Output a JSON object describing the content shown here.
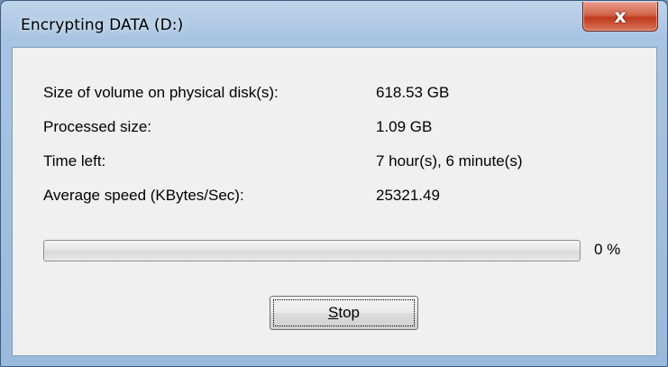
{
  "window": {
    "title": "Encrypting DATA (D:)",
    "close_glyph": "x"
  },
  "info_rows": [
    {
      "label": "Size of volume on physical disk(s):",
      "value": "618.53 GB"
    },
    {
      "label": "Processed size:",
      "value": "1.09 GB"
    },
    {
      "label": "Time left:",
      "value": "7 hour(s), 6 minute(s)"
    },
    {
      "label": "Average speed (KBytes/Sec):",
      "value": "25321.49"
    }
  ],
  "progress": {
    "percent": 0,
    "text": "0 %"
  },
  "stop_button": {
    "mnemonic": "S",
    "rest": "top"
  },
  "colors": {
    "close_button": "#c1391d",
    "progress_fill": "#37c12d",
    "dialog_background": "#f0f0f0"
  }
}
